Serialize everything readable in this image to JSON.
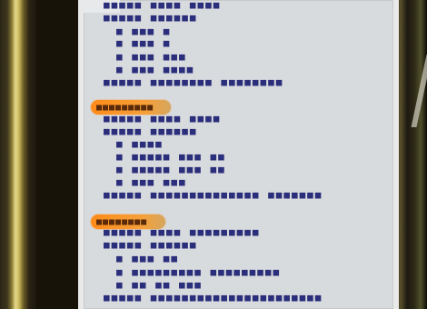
{
  "document": {
    "sections": [
      {
        "lines": [
          {
            "text": "■■■■■ ■■■■ ■■■■",
            "indent": false
          },
          {
            "text": "■■■■■ ■■■■■■",
            "indent": false
          },
          {
            "text": "■ ■■■ ■",
            "indent": true
          },
          {
            "text": "■ ■■■ ■",
            "indent": true
          },
          {
            "text": "■ ■■■ ■■■",
            "indent": true
          },
          {
            "text": "■ ■■■ ■■■■",
            "indent": true
          },
          {
            "text": "■■■■■ ■■■■■■■■ ■■■■■■■■",
            "indent": false
          }
        ]
      },
      {
        "tag": "■■■■■■■■■",
        "lines": [
          {
            "text": "■■■■■ ■■■■ ■■■■",
            "indent": false
          },
          {
            "text": "■■■■■ ■■■■■■",
            "indent": false
          },
          {
            "text": "■ ■■■■",
            "indent": true
          },
          {
            "text": "■ ■■■■■ ■■■ ■■",
            "indent": true
          },
          {
            "text": "■ ■■■■■ ■■■ ■■",
            "indent": true
          },
          {
            "text": "■ ■■■ ■■■",
            "indent": true
          },
          {
            "text": "■■■■■ ■■■■■■■■■■■■■■ ■■■■■■■",
            "indent": false
          }
        ]
      },
      {
        "tag": "■■■■■■■■",
        "lines": [
          {
            "text": "■■■■■ ■■■■ ■■■■■■■■■",
            "indent": false
          },
          {
            "text": "■■■■■ ■■■■■■",
            "indent": false
          },
          {
            "text": "■ ■■■ ■■",
            "indent": true
          },
          {
            "text": "■ ■■■■■■■■■ ■■■■■■■■■",
            "indent": true
          },
          {
            "text": "■ ■■ ■■ ■■■",
            "indent": true
          },
          {
            "text": "■■■■■ ■■■■■■■■■■■■■■■■■■■■■■",
            "indent": false
          }
        ]
      }
    ]
  }
}
